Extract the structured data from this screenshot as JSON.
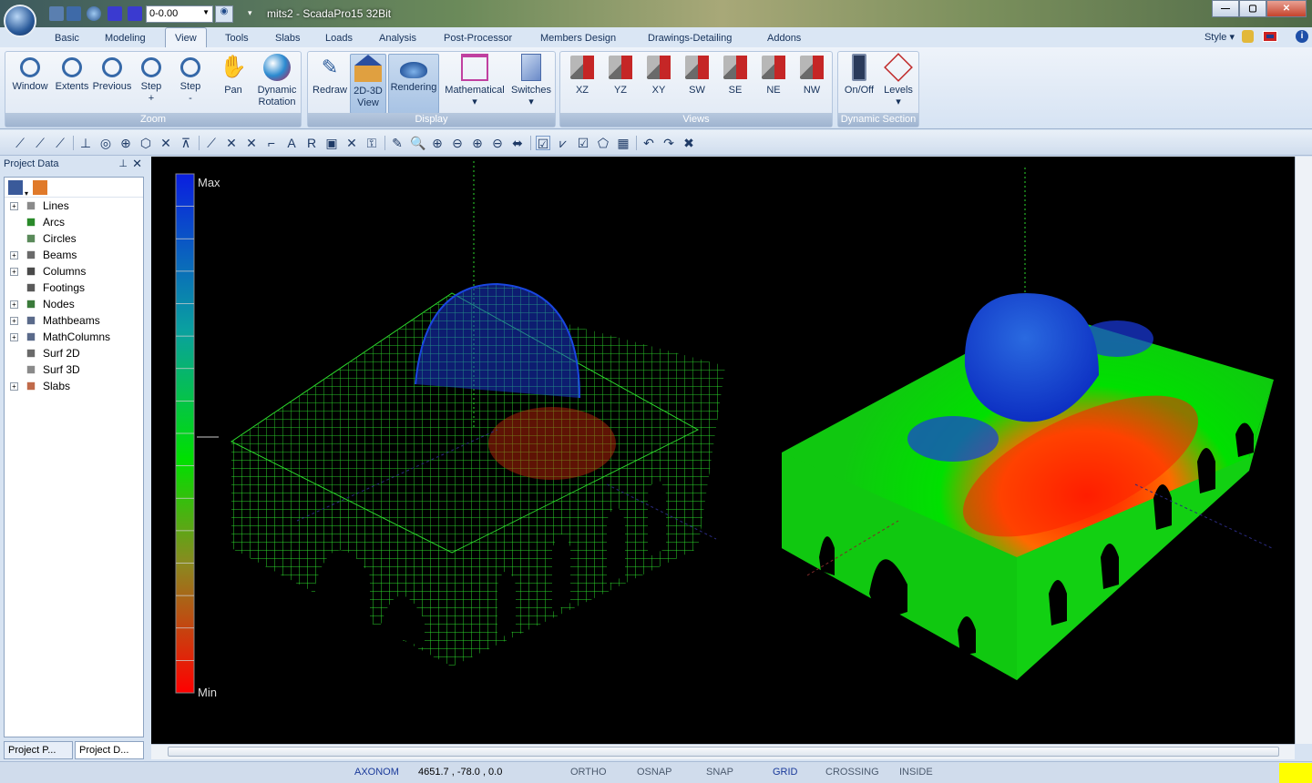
{
  "window": {
    "title": "mits2 - ScadaPro15 32Bit",
    "combo_value": "0-0.00"
  },
  "tabs": [
    "Basic",
    "Modeling",
    "View",
    "Tools",
    "Slabs",
    "Loads",
    "Analysis",
    "Post-Processor",
    "Members Design",
    "Drawings-Detailing",
    "Addons"
  ],
  "active_tab": "View",
  "style_label": "Style",
  "ribbon": {
    "zoom": {
      "caption": "Zoom",
      "buttons": [
        {
          "l1": "Window",
          "l2": ""
        },
        {
          "l1": "Extents",
          "l2": ""
        },
        {
          "l1": "Previous",
          "l2": ""
        },
        {
          "l1": "Step",
          "l2": "+"
        },
        {
          "l1": "Step",
          "l2": "-"
        },
        {
          "l1": "Pan",
          "l2": ""
        },
        {
          "l1": "Dynamic",
          "l2": "Rotation"
        }
      ]
    },
    "display": {
      "caption": "Display",
      "buttons": [
        {
          "l1": "Redraw",
          "l2": ""
        },
        {
          "l1": "2D-3D",
          "l2": "View"
        },
        {
          "l1": "Rendering",
          "l2": ""
        },
        {
          "l1": "Mathematical",
          "l2": "▾"
        },
        {
          "l1": "Switches",
          "l2": "▾"
        }
      ]
    },
    "views": {
      "caption": "Views",
      "buttons": [
        "XZ",
        "YZ",
        "XY",
        "SW",
        "SE",
        "NE",
        "NW"
      ]
    },
    "dynamic": {
      "caption": "Dynamic Section",
      "buttons": [
        {
          "l1": "On/Off",
          "l2": ""
        },
        {
          "l1": "Levels",
          "l2": "▾"
        }
      ]
    }
  },
  "panel": {
    "title": "Project Data",
    "items": [
      "Lines",
      "Arcs",
      "Circles",
      "Beams",
      "Columns",
      "Footings",
      "Nodes",
      "Mathbeams",
      "MathColumns",
      "Surf 2D",
      "Surf 3D",
      "Slabs"
    ],
    "bottom_tabs": [
      "Project P...",
      "Project D..."
    ]
  },
  "legend": {
    "max": "Max",
    "min": "Min"
  },
  "status": {
    "mode": "AXONOM",
    "coords": "4651.7 , -78.0 , 0.0",
    "toggles": [
      "ORTHO",
      "OSNAP",
      "SNAP",
      "GRID",
      "CROSSING",
      "INSIDE"
    ],
    "active": "GRID"
  },
  "colors": {
    "accent": "#d7e3f2",
    "status_highlight": "#ffff00"
  }
}
